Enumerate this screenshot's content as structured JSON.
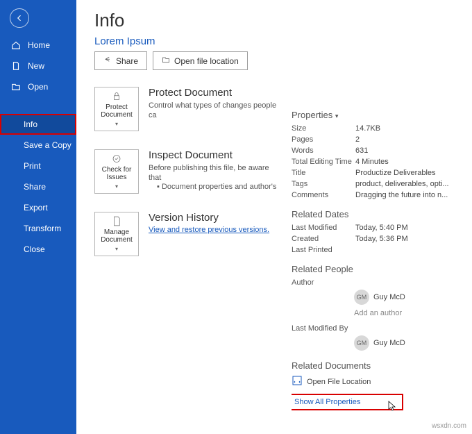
{
  "sidebar": {
    "items": [
      {
        "label": "Home"
      },
      {
        "label": "New"
      },
      {
        "label": "Open"
      },
      {
        "label": "Info"
      },
      {
        "label": "Save a Copy"
      },
      {
        "label": "Print"
      },
      {
        "label": "Share"
      },
      {
        "label": "Export"
      },
      {
        "label": "Transform"
      },
      {
        "label": "Close"
      }
    ]
  },
  "page": {
    "title": "Info",
    "doc_title": "Lorem Ipsum"
  },
  "buttons": {
    "share": "Share",
    "open_location": "Open file location"
  },
  "tiles": {
    "protect": {
      "box": "Protect Document",
      "head": "Protect Document",
      "sub": "Control what types of changes people ca"
    },
    "inspect": {
      "box": "Check for Issues",
      "head": "Inspect Document",
      "sub": "Before publishing this file, be aware that",
      "bullet": "Document properties and author's"
    },
    "version": {
      "box": "Manage Document",
      "head": "Version History",
      "link": "View and restore previous versions."
    }
  },
  "props": {
    "dropdown": "Properties",
    "rows": [
      {
        "k": "Size",
        "v": "14.7KB"
      },
      {
        "k": "Pages",
        "v": "2"
      },
      {
        "k": "Words",
        "v": "631"
      },
      {
        "k": "Total Editing Time",
        "v": "4 Minutes"
      },
      {
        "k": "Title",
        "v": "Productize Deliverables"
      },
      {
        "k": "Tags",
        "v": "product, deliverables, opti..."
      },
      {
        "k": "Comments",
        "v": "Dragging the future into n..."
      }
    ]
  },
  "dates": {
    "head": "Related Dates",
    "rows": [
      {
        "k": "Last Modified",
        "v": "Today, 5:40 PM"
      },
      {
        "k": "Created",
        "v": "Today, 5:36 PM"
      },
      {
        "k": "Last Printed",
        "v": ""
      }
    ]
  },
  "people": {
    "head": "Related People",
    "author_label": "Author",
    "author_initials": "GM",
    "author_name": "Guy McD",
    "add_author": "Add an author",
    "modified_label": "Last Modified By",
    "modified_initials": "GM",
    "modified_name": "Guy McD"
  },
  "docs": {
    "head": "Related Documents",
    "open": "Open File Location",
    "showall": "Show All Properties"
  },
  "watermark": "wsxdn.com"
}
